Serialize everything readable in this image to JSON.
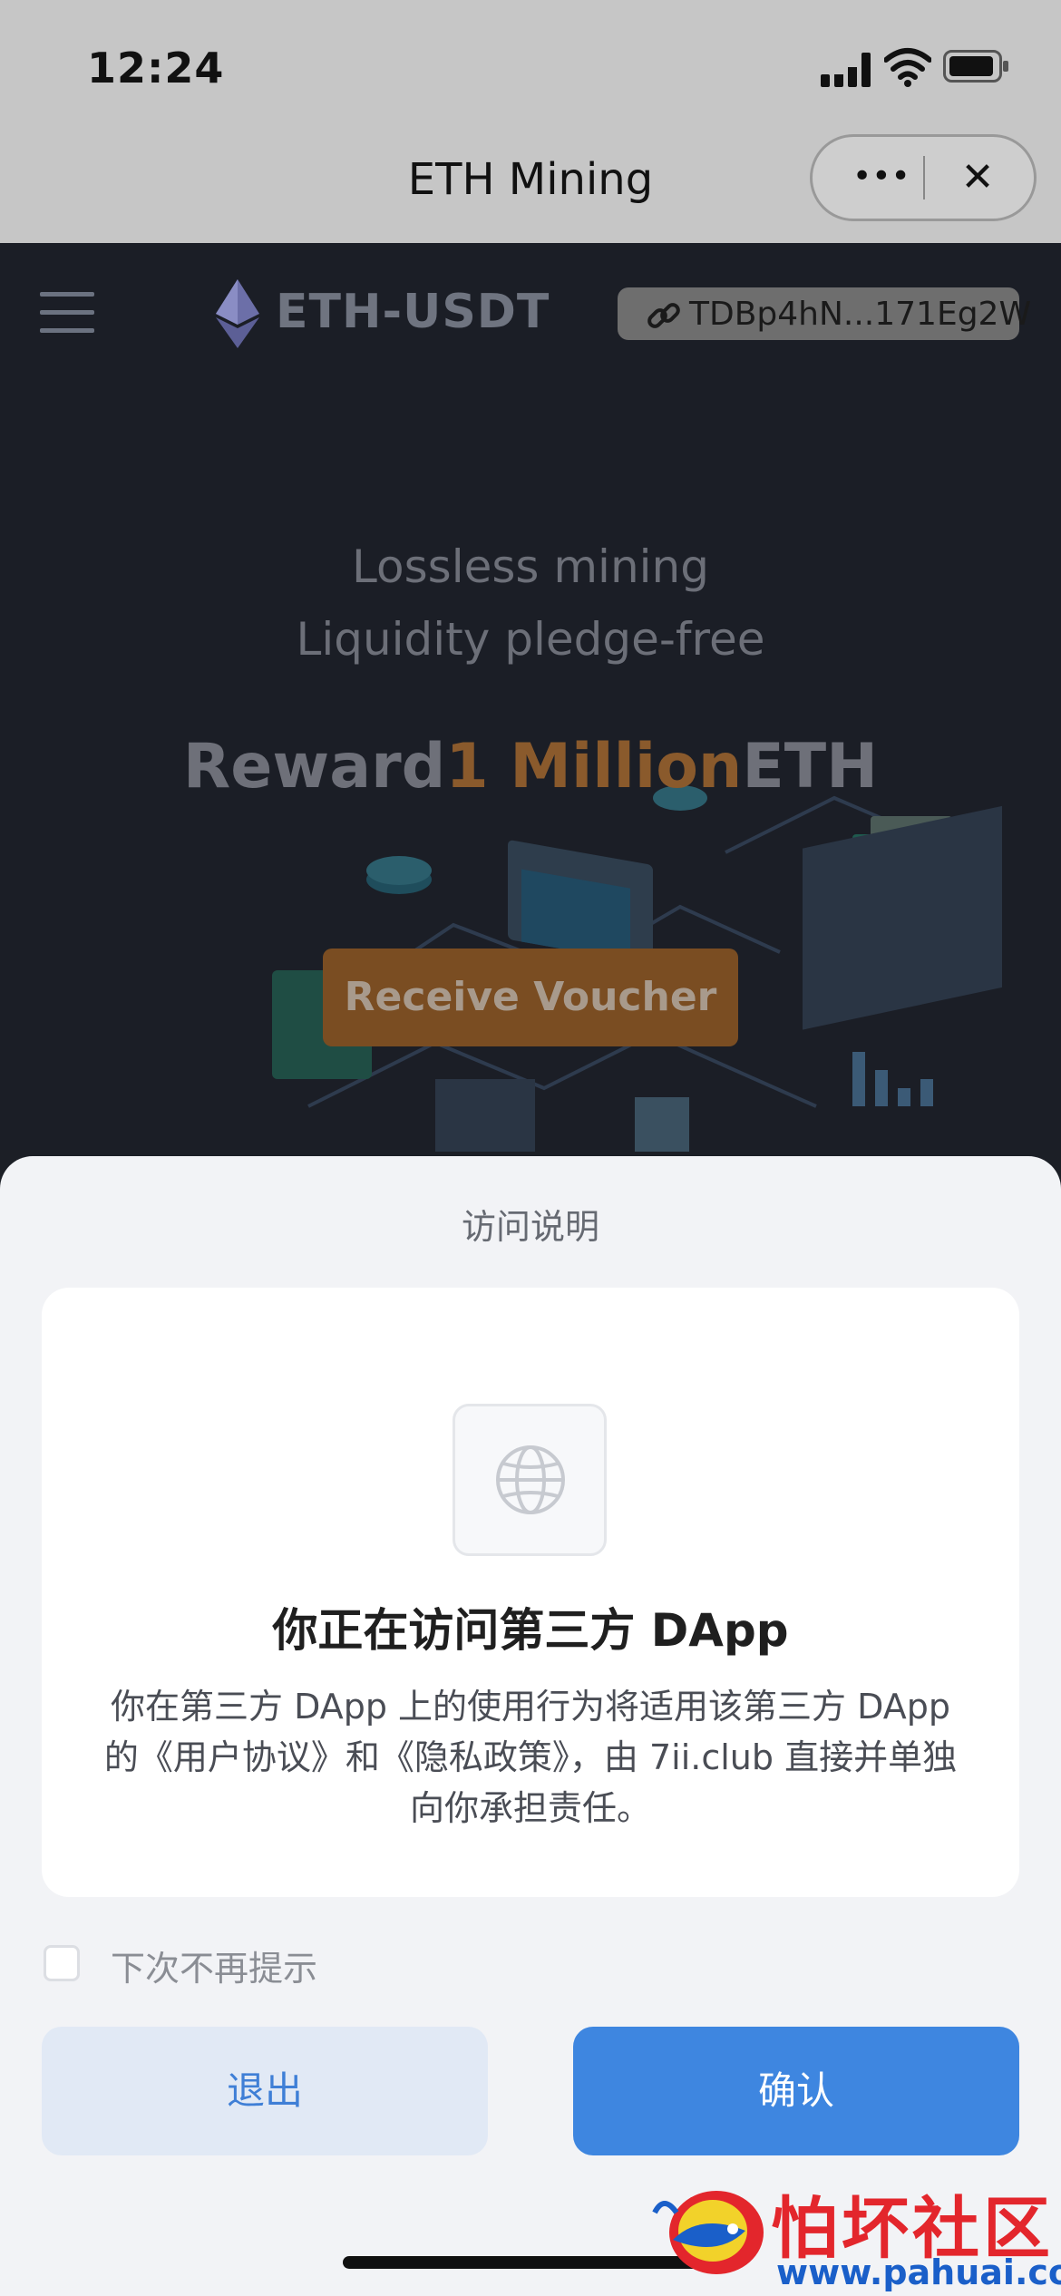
{
  "status_bar": {
    "time": "12:24"
  },
  "header": {
    "title": "ETH Mining",
    "more_label": "•••",
    "close_label": "✕"
  },
  "dapp": {
    "brand": "ETH-USDT",
    "wallet_address": "TDBp4hN...171Eg2W",
    "hero_line1": "Lossless mining",
    "hero_line2": "Liquidity pledge-free",
    "reward_prefix": "Reward",
    "reward_highlight": "1 Million",
    "reward_suffix": "ETH",
    "voucher_button": "Receive Voucher"
  },
  "sheet": {
    "title": "访问说明",
    "card_title": "你正在访问第三方 DApp",
    "card_body": "你在第三方 DApp 上的使用行为将适用该第三方 DApp 的《用户协议》和《隐私政策》，由 7ii.club 直接并单独向你承担责任。",
    "checkbox_label": "下次不再提示",
    "exit_button": "退出",
    "confirm_button": "确认"
  },
  "watermark": {
    "name": "怕坏社区",
    "url": "www.pahuai.com"
  },
  "colors": {
    "confirm": "#3e86e0",
    "exit_bg": "#e1e9f5",
    "voucher": "#7a4d22",
    "reward_highlight": "#8a5a2c",
    "watermark_red": "#e3262c",
    "watermark_blue": "#1a5fc9"
  },
  "icons": [
    "menu-icon",
    "ethereum-icon",
    "link-icon",
    "globe-icon",
    "signal-icon",
    "wifi-icon",
    "battery-icon"
  ]
}
